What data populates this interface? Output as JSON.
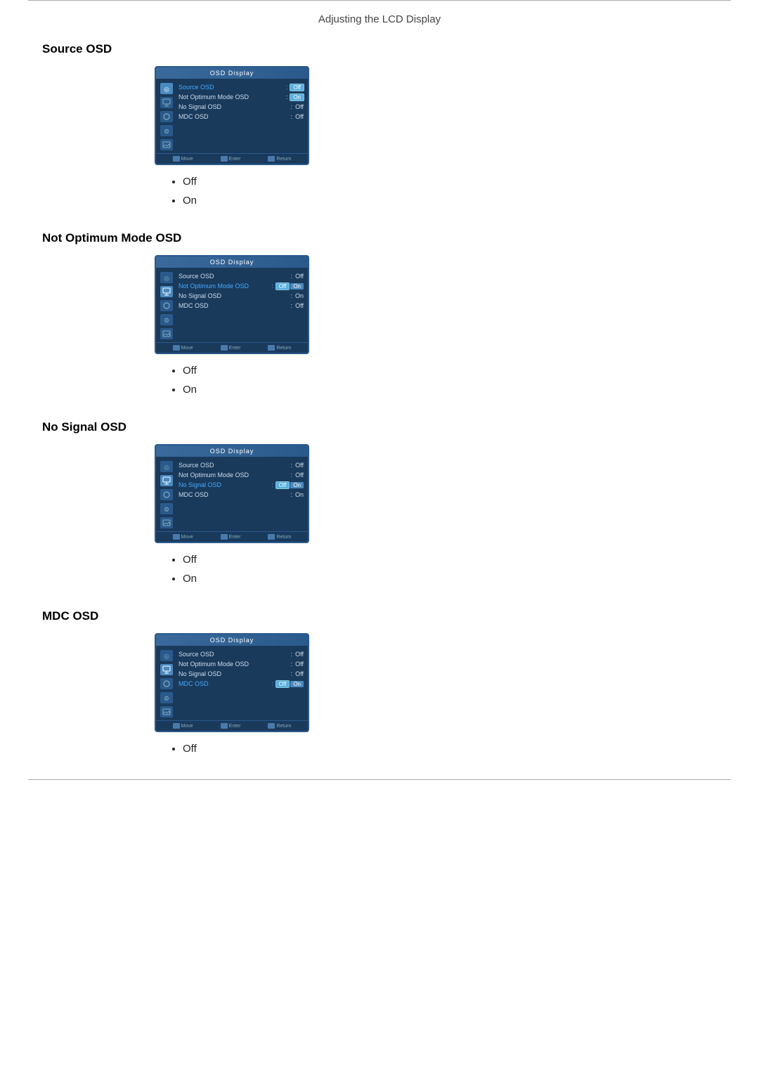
{
  "page": {
    "title": "Adjusting the LCD Display"
  },
  "sections": [
    {
      "id": "source-osd",
      "title": "Source OSD",
      "osd": {
        "titleBar": "OSD Display",
        "rows": [
          {
            "label": "Source OSD",
            "value": "Off",
            "highlighted": true,
            "selectedBox": "Off",
            "extraBox": null
          },
          {
            "label": "Not Optimum Mode OSD",
            "value": "On",
            "highlighted": false,
            "selectedBox": "On",
            "extraBox": null
          },
          {
            "label": "No Signal OSD",
            "value": "Off",
            "highlighted": false,
            "selectedBox": null,
            "extraBox": null
          },
          {
            "label": "MDC OSD",
            "value": "Off",
            "highlighted": false,
            "selectedBox": null,
            "extraBox": null
          }
        ],
        "activeIconIndex": 0
      },
      "bullets": [
        "Off",
        "On"
      ]
    },
    {
      "id": "not-optimum-mode-osd",
      "title": "Not Optimum Mode OSD",
      "osd": {
        "titleBar": "OSD Display",
        "rows": [
          {
            "label": "Source OSD",
            "value": "Off",
            "highlighted": false,
            "selectedBox": null,
            "extraBox": null
          },
          {
            "label": "Not Optimum Mode OSD",
            "value": "Off",
            "highlighted": true,
            "selectedBox": "Off",
            "extraBox": "On"
          },
          {
            "label": "No Signal OSD",
            "value": "On",
            "highlighted": false,
            "selectedBox": null,
            "extraBox": null
          },
          {
            "label": "MDC OSD",
            "value": "Off",
            "highlighted": false,
            "selectedBox": null,
            "extraBox": null
          }
        ],
        "activeIconIndex": 1
      },
      "bullets": [
        "Off",
        "On"
      ]
    },
    {
      "id": "no-signal-osd",
      "title": "No Signal OSD",
      "osd": {
        "titleBar": "OSD Display",
        "rows": [
          {
            "label": "Source OSD",
            "value": "Off",
            "highlighted": false,
            "selectedBox": null,
            "extraBox": null
          },
          {
            "label": "Not Optimum Mode OSD",
            "value": "Off",
            "highlighted": false,
            "selectedBox": null,
            "extraBox": null
          },
          {
            "label": "No Signal OSD",
            "value": "Off",
            "highlighted": true,
            "selectedBox": "Off",
            "extraBox": "On"
          },
          {
            "label": "MDC OSD",
            "value": "On",
            "highlighted": false,
            "selectedBox": null,
            "extraBox": null
          }
        ],
        "activeIconIndex": 1
      },
      "bullets": [
        "Off",
        "On"
      ]
    },
    {
      "id": "mdc-osd",
      "title": "MDC OSD",
      "osd": {
        "titleBar": "OSD Display",
        "rows": [
          {
            "label": "Source OSD",
            "value": "Off",
            "highlighted": false,
            "selectedBox": null,
            "extraBox": null
          },
          {
            "label": "Not Optimum Mode OSD",
            "value": "Off",
            "highlighted": false,
            "selectedBox": null,
            "extraBox": null
          },
          {
            "label": "No Signal OSD",
            "value": "Off",
            "highlighted": false,
            "selectedBox": null,
            "extraBox": null
          },
          {
            "label": "MDC OSD",
            "value": "Off",
            "highlighted": true,
            "selectedBox": "Off",
            "extraBox": "On"
          }
        ],
        "activeIconIndex": 1
      },
      "bullets": [
        "Off"
      ]
    }
  ],
  "osd": {
    "footer": {
      "move": "Move",
      "enter": "Enter",
      "return": "Return"
    },
    "icons": [
      "antenna",
      "display",
      "circle",
      "gear",
      "photo"
    ]
  }
}
